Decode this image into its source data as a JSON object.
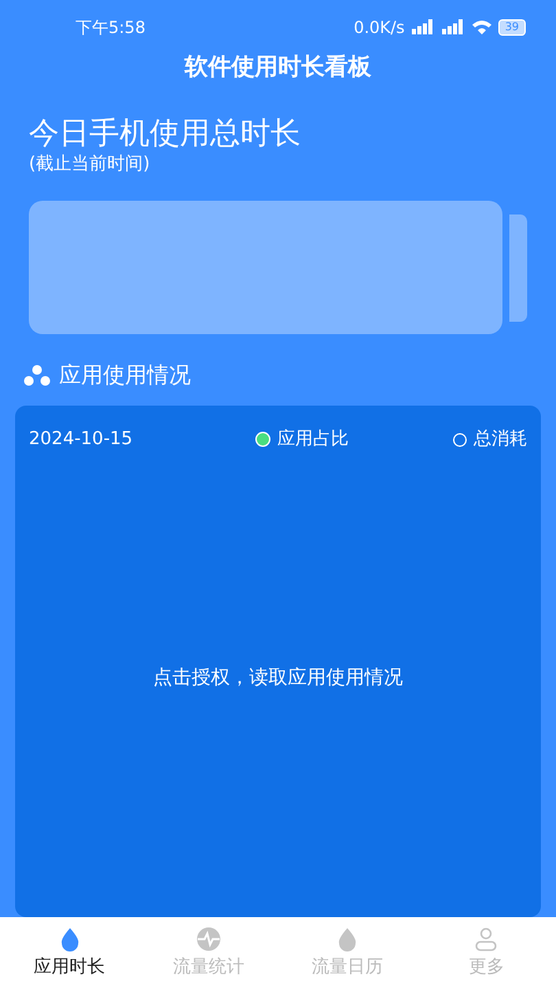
{
  "status_bar": {
    "time": "下午5:58",
    "speed": "0.0K/s",
    "battery": "39"
  },
  "title": "软件使用时长看板",
  "summary": {
    "heading": "今日手机使用总时长",
    "subheading": "(截止当前时间)"
  },
  "section": {
    "title": "应用使用情况"
  },
  "card": {
    "date": "2024-10-15",
    "legend": [
      {
        "label": "应用占比",
        "selected": true
      },
      {
        "label": "总消耗",
        "selected": false
      }
    ],
    "message": "点击授权，读取应用使用情况"
  },
  "tabs": [
    {
      "label": "应用时长",
      "kind": "drop",
      "selected": true
    },
    {
      "label": "流量统计",
      "kind": "pulse",
      "selected": false
    },
    {
      "label": "流量日历",
      "kind": "drop",
      "selected": false
    },
    {
      "label": "更多",
      "kind": "person",
      "selected": false
    }
  ]
}
